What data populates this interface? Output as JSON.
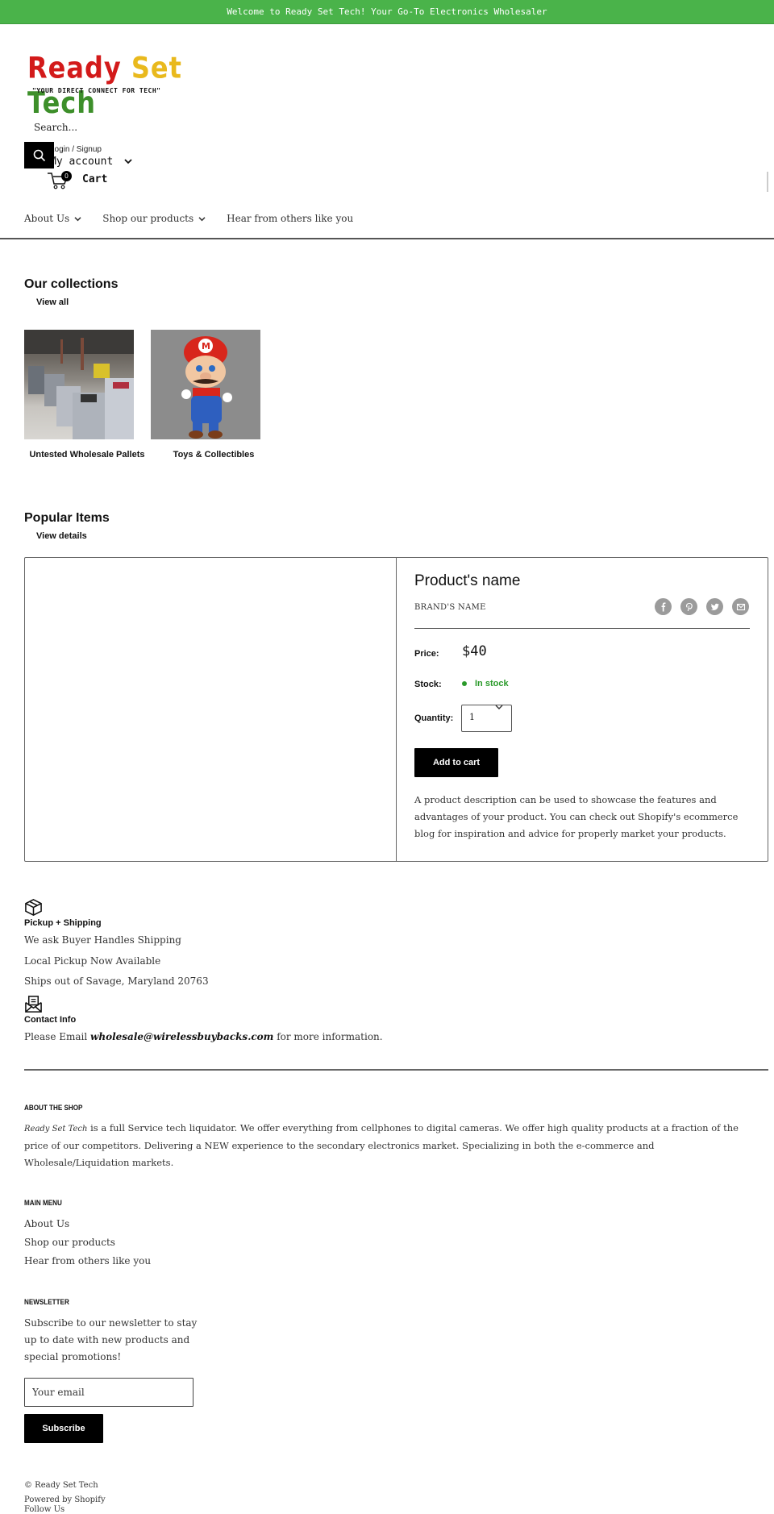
{
  "announcement": "Welcome to Ready Set Tech! Your Go-To Electronics Wholesaler",
  "header": {
    "logo": {
      "word1": "Ready",
      "word2": "Set",
      "word3": "Tech",
      "tagline": "\"YOUR DIRECT CONNECT FOR TECH\""
    },
    "search_placeholder": "Search...",
    "login_label": "Login / Signup",
    "account_label": "My account",
    "cart_label": "Cart",
    "cart_count": "0"
  },
  "nav": {
    "items": [
      {
        "label": "About Us",
        "dropdown": true
      },
      {
        "label": "Shop our products",
        "dropdown": true
      },
      {
        "label": "Hear from others like you",
        "dropdown": false
      }
    ]
  },
  "collections": {
    "title": "Our collections",
    "view_all": "View all",
    "items": [
      {
        "title": "Untested Wholesale Pallets",
        "image": "warehouse-pallets-photo"
      },
      {
        "title": "Toys & Collectibles",
        "image": "mario-figure-photo"
      }
    ]
  },
  "popular": {
    "title": "Popular Items",
    "view_details": "View details",
    "product": {
      "name": "Product's name",
      "brand": "BRAND'S NAME",
      "share_icons": [
        "facebook-icon",
        "pinterest-icon",
        "twitter-icon",
        "email-icon"
      ],
      "price_label": "Price:",
      "price": "$40",
      "stock_label": "Stock:",
      "stock": "In stock",
      "quantity_label": "Quantity:",
      "quantity": "1",
      "add_to_cart": "Add to cart",
      "description": "A product description can be used to showcase the features and advantages of your product. You can check out Shopify's ecommerce blog for inspiration and advice for properly market your products."
    }
  },
  "features": [
    {
      "icon": "box-icon",
      "title": "Pickup + Shipping",
      "lines": [
        "We ask Buyer Handles Shipping",
        "Local Pickup Now Available",
        "Ships out of Savage, Maryland 20763"
      ]
    },
    {
      "icon": "envelope-icon",
      "title": "Contact Info",
      "prefix": "Please Email ",
      "email": "wholesale@wirelessbuybacks.com",
      "suffix": " for more information."
    }
  ],
  "footer": {
    "about_title": "ABOUT THE SHOP",
    "about_brand": "Ready Set Tech",
    "about_text": " is a full Service tech liquidator. We offer everything from cellphones to digital cameras. We offer high quality products at a fraction of the price of our competitors. Delivering a NEW experience to the secondary electronics market. Specializing in both the e-commerce and Wholesale/Liquidation markets.",
    "menu_title": "MAIN MENU",
    "menu_items": [
      "About Us",
      "Shop our products",
      "Hear from others like you"
    ],
    "newsletter_title": "NEWSLETTER",
    "newsletter_text": "Subscribe to our newsletter to stay up to date with new products and special promotions!",
    "email_placeholder": "Your email",
    "subscribe": "Subscribe",
    "copyright": "© Ready Set Tech",
    "powered": "Powered by Shopify",
    "follow": "Follow Us"
  },
  "colors": {
    "announcement_bg": "#4ab34a",
    "stock_green": "#2a9a2a",
    "button_bg": "#000000"
  }
}
